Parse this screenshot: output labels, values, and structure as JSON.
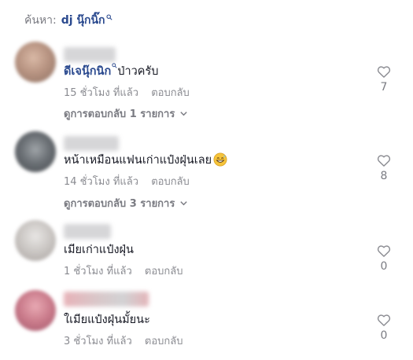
{
  "search": {
    "label": "ค้นหา:",
    "query": "dj นุ๊กนิ๊ก",
    "icon": "search-icon"
  },
  "colors": {
    "link": "#2b4a8f",
    "secondary_text": "#8a8b91",
    "heart_outline": "#8a8b91"
  },
  "comments": [
    {
      "mention": "ดีเจนุ๊กนิก",
      "text": "ป่าวครับ",
      "time": "15 ชั่วโมง ที่แล้ว",
      "reply_label": "ตอบกลับ",
      "view_replies": "ดูการตอบกลับ 1 รายการ",
      "likes": "7"
    },
    {
      "text": "หน้าเหมือนแฟนเก่าแป๋งฝุ่นเลย",
      "emoji": "grinning-sweat-emoji",
      "time": "14 ชั่วโมง ที่แล้ว",
      "reply_label": "ตอบกลับ",
      "view_replies": "ดูการตอบกลับ 3 รายการ",
      "likes": "8"
    },
    {
      "text": "เมียเก่าแป๋งฝุ่น",
      "time": "1 ชั่วโมง ที่แล้ว",
      "reply_label": "ตอบกลับ",
      "likes": "0"
    },
    {
      "text": "ใเมียแป๋งฝุ่นมั้ยนะ",
      "time": "3 ชั่วโมง ที่แล้ว",
      "reply_label": "ตอบกลับ",
      "likes": "0"
    }
  ]
}
